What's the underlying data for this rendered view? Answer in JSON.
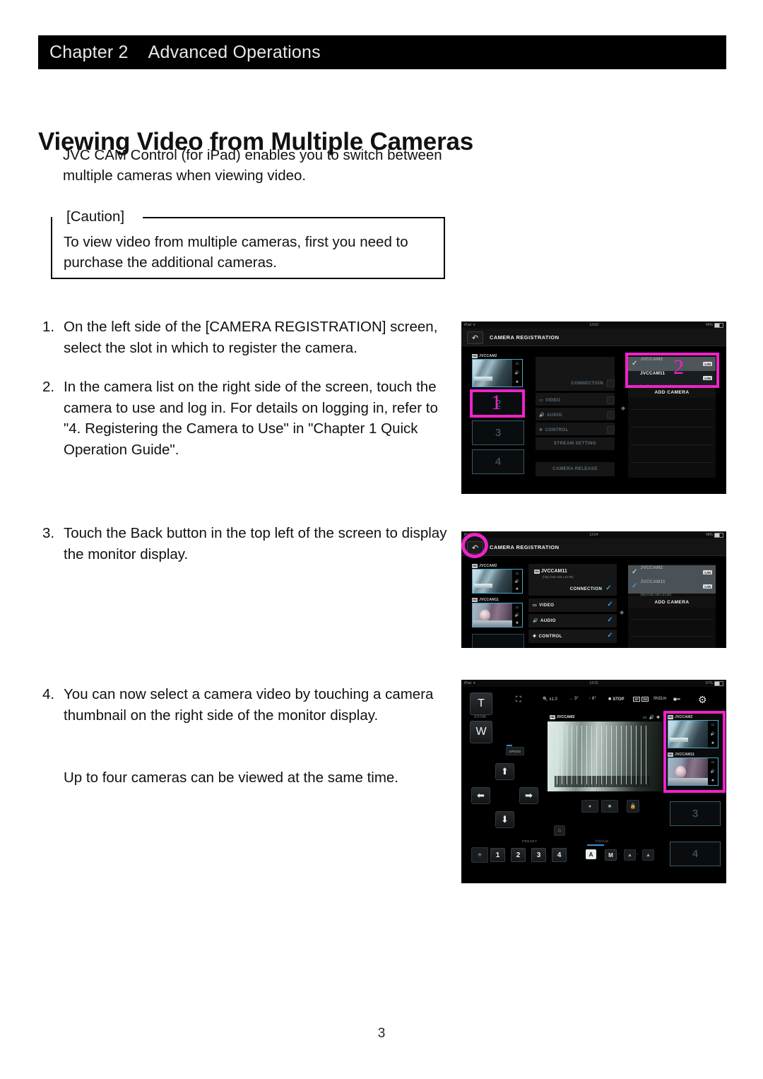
{
  "header": {
    "chapter": "Chapter 2",
    "chapter_title": "Advanced Operations"
  },
  "title": "Viewing Video from Multiple Cameras",
  "intro": "JVC CAM Control (for iPad) enables you to switch between multiple cameras when viewing video.",
  "caution": {
    "label": "[Caution]",
    "text": "To view video from multiple cameras, first you need to purchase the additional cameras."
  },
  "steps": [
    {
      "num": "1.",
      "text": "On the left side of the [CAMERA REGISTRATION] screen, select the slot in which to register the camera."
    },
    {
      "num": "2.",
      "text": "In the camera list on the right side of the screen, touch the camera to use and log in. For details on logging in, refer to \"4. Registering the Camera to Use\" in \"Chapter 1 Quick Operation Guide\"."
    },
    {
      "num": "3.",
      "text": "Touch the Back button in the top left of the screen to display the monitor display."
    },
    {
      "num": "4.",
      "text": "You can now select a camera video by touching a camera thumbnail on the right side of the monitor display."
    }
  ],
  "step4_note": "Up to four cameras can be viewed at the same time.",
  "page_number": "3",
  "colors": {
    "annotation": "#ee23c8",
    "accent_blue": "#2f9fe8",
    "selection": "#49a7c9"
  },
  "shot1": {
    "status": {
      "device": "iPad",
      "wifi": "wifi-icon",
      "time": "13:53",
      "battery": "46%"
    },
    "nav": {
      "back_icon": "back-arrow-icon",
      "title": "CAMERA REGISTRATION"
    },
    "thumb": {
      "tag": "HD",
      "name": "JVCCAM2"
    },
    "slots": [
      "2",
      "3",
      "4"
    ],
    "settings": [
      {
        "label": "CONNECTION",
        "icon": ""
      },
      {
        "label": "VIDEO",
        "icon": "video-icon"
      },
      {
        "label": "AUDIO",
        "icon": "audio-icon"
      },
      {
        "label": "CONTROL",
        "icon": "control-icon"
      },
      {
        "label": "STREAM SETTING",
        "icon": ""
      },
      {
        "label": "CAMERA RELEASE",
        "icon": ""
      }
    ],
    "cameras": [
      {
        "name": "JVCCAM2",
        "url": "(http://192.168.1.10:80)",
        "badge": "LAN",
        "checked": true
      },
      {
        "name": "JVCCAM11",
        "url": "(http://192.168.1.91:80)",
        "badge": "LAN",
        "checked": false
      }
    ],
    "add_camera": "ADD CAMERA",
    "annotations": {
      "left": "1",
      "right": "2"
    }
  },
  "shot2": {
    "status": {
      "device": "iPad",
      "wifi": "wifi-icon",
      "time": "13:54",
      "battery": "48%"
    },
    "nav": {
      "back_icon": "back-arrow-icon",
      "title": "CAMERA REGISTRATION"
    },
    "thumbs": [
      {
        "tag": "HD",
        "name": "JVCCAM2"
      },
      {
        "tag": "HD",
        "name": "JVCCAM11"
      }
    ],
    "selected_camera": {
      "tag": "HD",
      "name": "JVCCAM11",
      "url": "(http://192.168.1.91:80)"
    },
    "settings": [
      {
        "label": "CONNECTION",
        "icon": "",
        "checked": true
      },
      {
        "label": "VIDEO",
        "icon": "video-icon",
        "checked": true
      },
      {
        "label": "AUDIO",
        "icon": "audio-icon",
        "checked": true
      },
      {
        "label": "CONTROL",
        "icon": "control-icon",
        "checked": true
      }
    ],
    "cameras": [
      {
        "name": "JVCCAM2",
        "url": "(http://192.168.1.10:80)",
        "badge": "LAN",
        "checked": true
      },
      {
        "name": "JVCCAM11",
        "url": "(http://192.168.1.91:80)",
        "badge": "LAN",
        "checked": true
      }
    ],
    "add_camera": "ADD CAMERA"
  },
  "shot3": {
    "status": {
      "device": "iPad",
      "wifi": "wifi-icon",
      "time": "14:22",
      "battery": "67%"
    },
    "toolbar": {
      "zoom_value": "x1.0",
      "pan_value": "3°",
      "tilt_value": "6°",
      "rec_status": "STOP",
      "quality": "XF",
      "media": "SD",
      "remaining": "0h31m",
      "battery_icon": "battery-icon",
      "gear_icon": "gear-icon"
    },
    "zoom_controls": {
      "tele": "T",
      "wide": "W",
      "label": "ZOOM",
      "speed": "SPEED"
    },
    "main_video": {
      "tag": "HD",
      "name": "JVCCAM2"
    },
    "thumbs": [
      {
        "tag": "HD",
        "name": "JVCCAM2"
      },
      {
        "tag": "HD",
        "name": "JVCCAM11"
      }
    ],
    "empty_slots": [
      "3",
      "4"
    ],
    "preset": {
      "label": "PRESET",
      "buttons": [
        "1",
        "2",
        "3",
        "4"
      ],
      "home_icon": "home-preset-icon"
    },
    "focus": {
      "label": "FOCUS",
      "auto": "A",
      "manual": "M",
      "near_icon": "focus-near-icon",
      "far_icon": "focus-far-icon"
    },
    "lock_icon": "lock-icon"
  }
}
